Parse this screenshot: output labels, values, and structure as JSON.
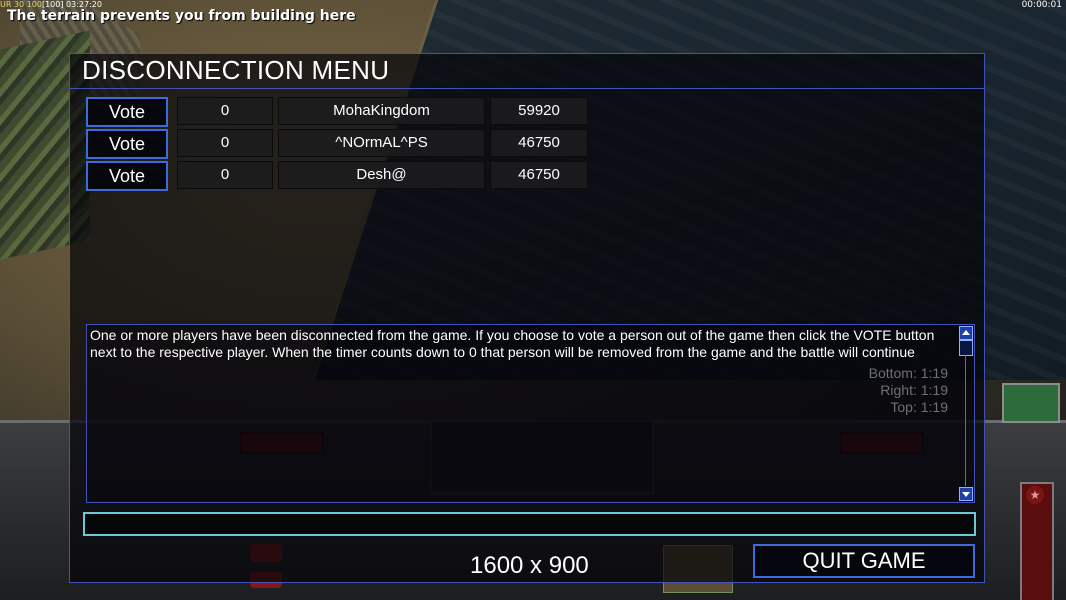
{
  "hud": {
    "stats_prefix": "UR 30",
    "stats_val1": "100",
    "stats_val2": "100",
    "stats_time": "03:27:20",
    "status_message": "The terrain prevents you from building here",
    "clock": "00:00:01"
  },
  "menu": {
    "title": "DISCONNECTION MENU",
    "vote_label": "Vote",
    "players": [
      {
        "timer": "0",
        "name": "MohaKingdom",
        "score": "59920"
      },
      {
        "timer": "0",
        "name": "^NOrmAL^PS",
        "score": "46750"
      },
      {
        "timer": "0",
        "name": "Desh@",
        "score": "46750"
      }
    ],
    "message": "One or more players have been disconnected from the game. If you choose to vote a person out of the game then click the VOTE button next to the respective player. When the timer counts down to 0 that person will be removed from the game and the battle will continue",
    "background_overlay": {
      "bottom": "Bottom: 1:19",
      "right": "Right: 1:19",
      "top": "Top: 1:19"
    },
    "chat_value": "",
    "resolution": "1600 x 900",
    "quit_label": "QUIT GAME"
  },
  "colors": {
    "panel_border": "#4152b8",
    "button_border": "#3d6bdc",
    "chat_border": "#69c9d4"
  }
}
